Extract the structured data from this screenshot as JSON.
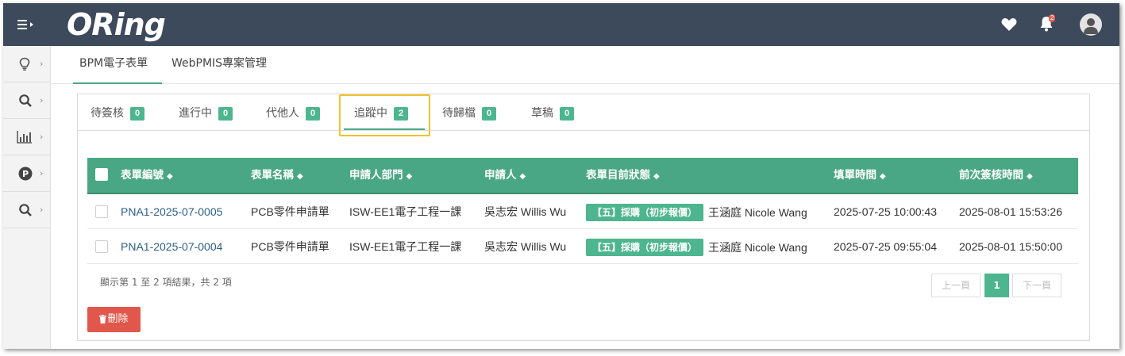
{
  "header": {
    "logo": "ORing",
    "notification_count": "2"
  },
  "top_tabs": [
    {
      "label": "BPM電子表單",
      "active": true
    },
    {
      "label": "WebPMIS專案管理",
      "active": false
    }
  ],
  "sub_tabs": [
    {
      "label": "待簽核",
      "count": "0"
    },
    {
      "label": "進行中",
      "count": "0"
    },
    {
      "label": "代他人",
      "count": "0"
    },
    {
      "label": "追蹤中",
      "count": "2",
      "active": true
    },
    {
      "label": "待歸檔",
      "count": "0"
    },
    {
      "label": "草稿",
      "count": "0"
    }
  ],
  "table": {
    "columns": [
      "表單編號",
      "表單名稱",
      "申請人部門",
      "申請人",
      "表單目前狀態",
      "填單時間",
      "前次簽核時間"
    ],
    "rows": [
      {
        "form_no": "PNA1-2025-07-0005",
        "form_name": "PCB零件申請單",
        "dept": "ISW-EE1電子工程一課",
        "applicant": "吳志宏 Willis Wu",
        "status_tag": "【五】採購（初步報價）",
        "status_person": "王涵庭 Nicole Wang",
        "fill_time": "2025-07-25 10:00:43",
        "last_sign_time": "2025-08-01 15:53:26"
      },
      {
        "form_no": "PNA1-2025-07-0004",
        "form_name": "PCB零件申請單",
        "dept": "ISW-EE1電子工程一課",
        "applicant": "吳志宏 Willis Wu",
        "status_tag": "【五】採購（初步報價）",
        "status_person": "王涵庭 Nicole Wang",
        "fill_time": "2025-07-25 09:55:04",
        "last_sign_time": "2025-08-01 15:50:00"
      }
    ]
  },
  "footer": {
    "info": "顯示第 1 至 2 項結果，共 2 項",
    "prev": "上一頁",
    "page": "1",
    "next": "下一頁",
    "delete": "刪除"
  },
  "colors": {
    "topbar": "#3d4a5c",
    "accent": "#4db58f",
    "danger": "#e2574c",
    "highlight": "#f2c12e"
  }
}
